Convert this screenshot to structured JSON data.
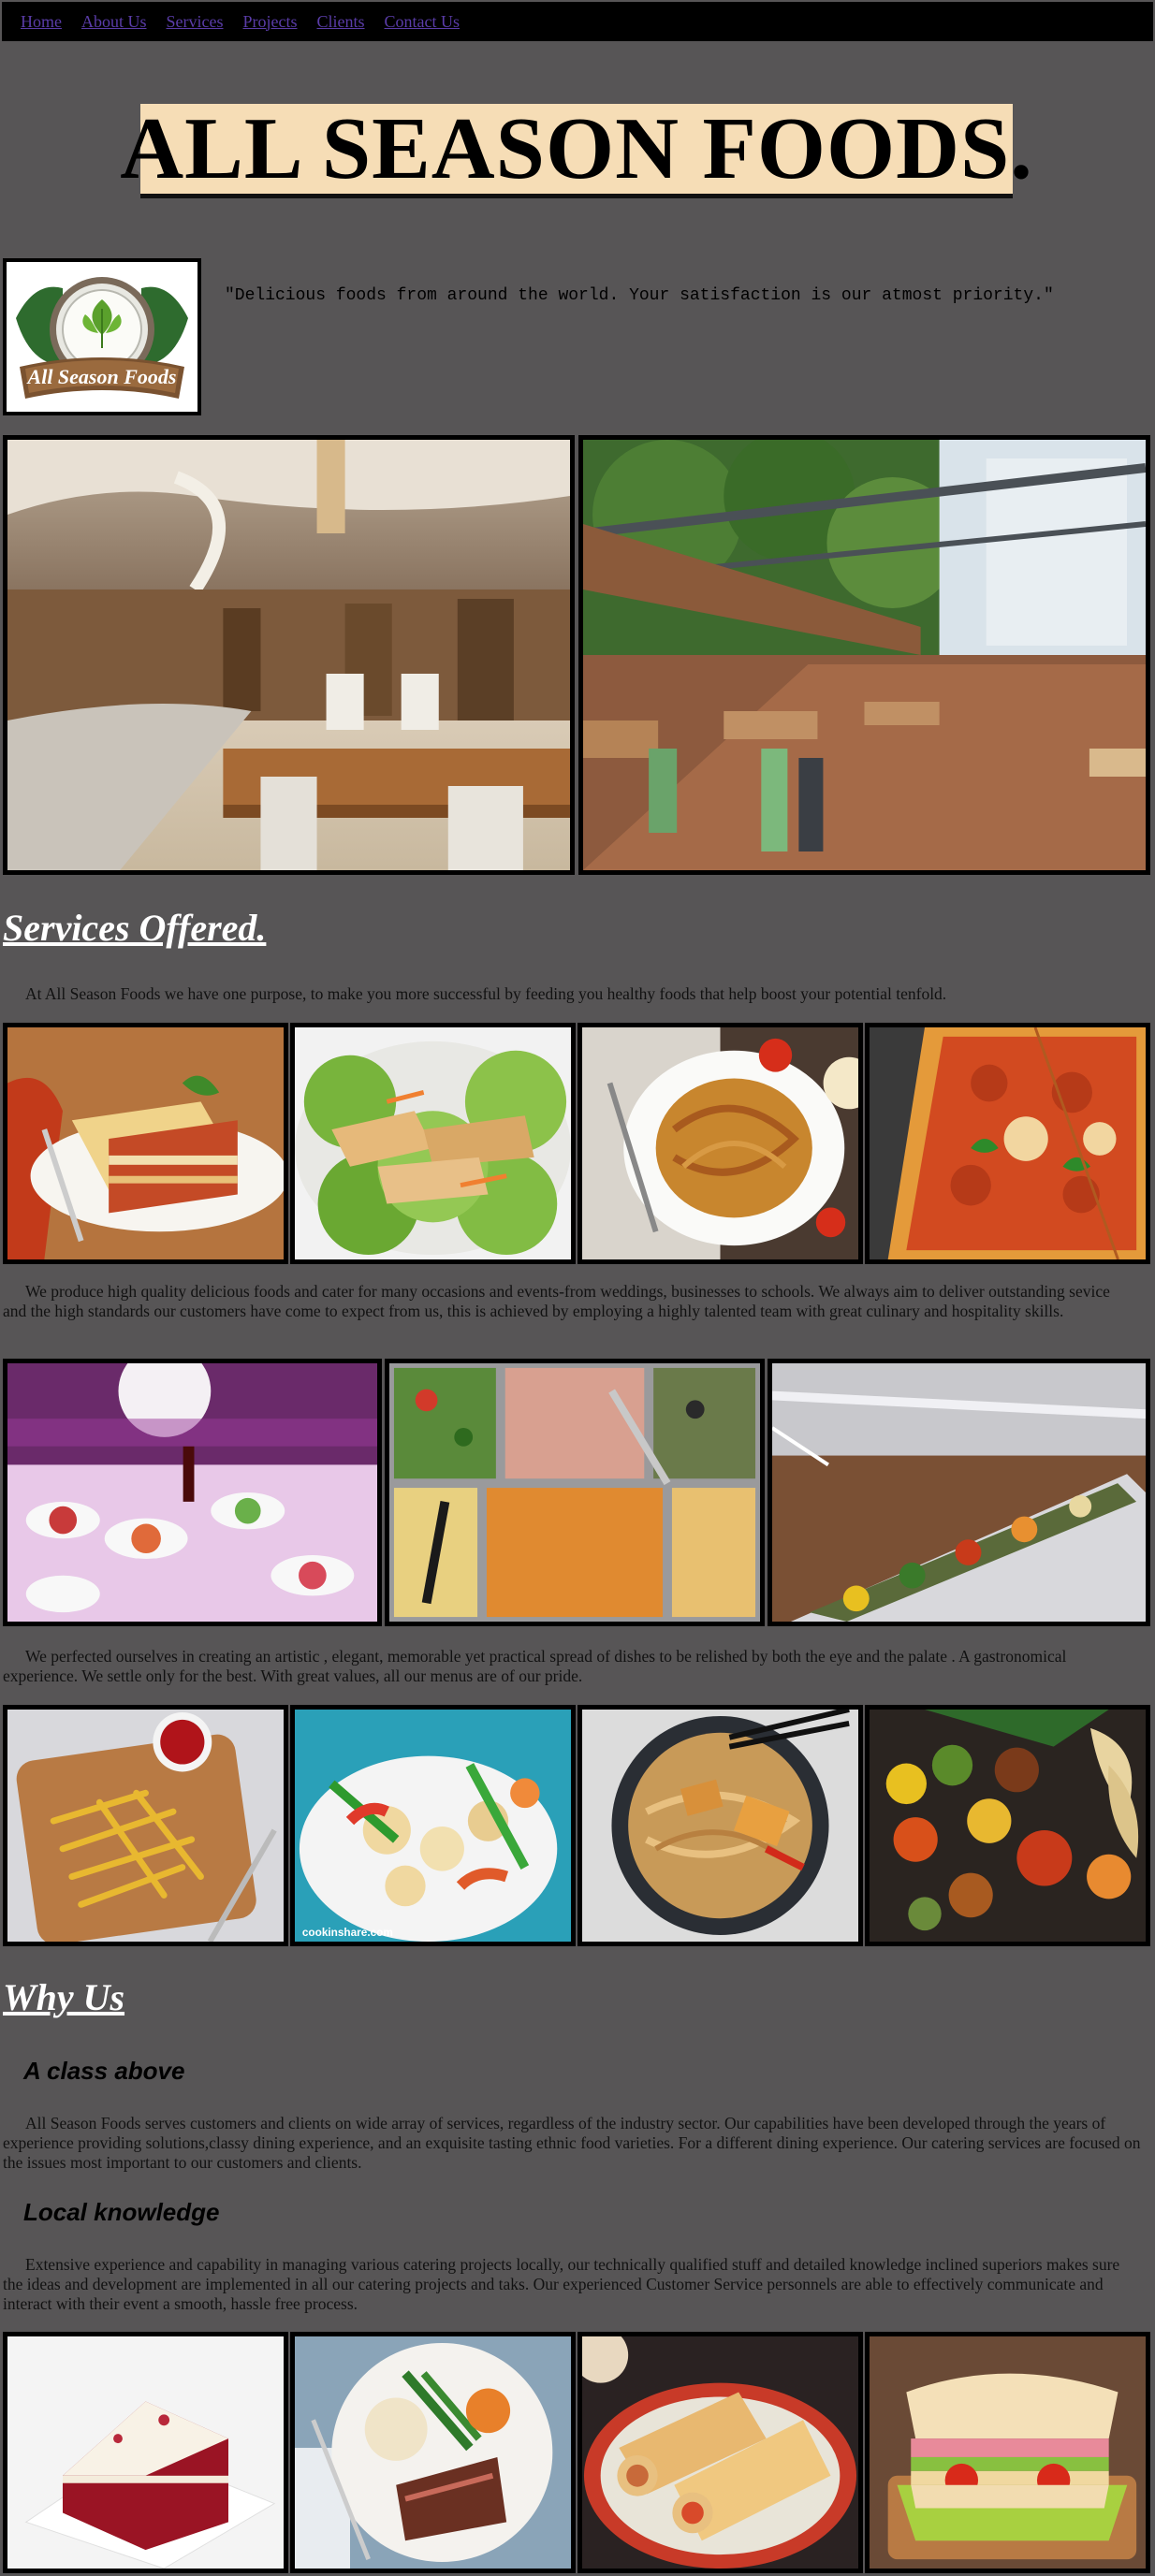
{
  "nav": {
    "items": [
      "Home",
      "About Us",
      "Services",
      "Projects",
      "Clients",
      "Contact Us"
    ]
  },
  "header": {
    "title": "ALL SEASON FOODS.",
    "tagline": "\"Delicious foods from around the world. Your satisfaction is our atmost priority.\"",
    "logo_text": "All Season Foods"
  },
  "services": {
    "heading": "Services Offered.",
    "intro": "At All Season Foods we have one purpose, to make you more successful by feeding you healthy foods that help boost your potential tenfold.",
    "para2": "We produce high quality delicious foods and cater for many occasions and events-from weddings, businesses to schools. We always aim to deliver outstanding sevice and the high standards our customers have come to expect from us, this is achieved by employing a highly talented team with great culinary and hospitality skills.",
    "para3": "We perfected ourselves in creating an artistic , elegant, memorable yet practical spread of dishes to be relished by both the eye and the palate . A gastronomical experience. We settle only for the best. With great values, all our menus are of our pride."
  },
  "why_us": {
    "heading": "Why Us",
    "sub1": "A class above",
    "para1": "All Season Foods serves customers and clients on wide array of services, regardless of the industry sector. Our capabilities have been developed through the years of experience providing solutions,classy dining experience, and an exquisite tasting ethnic food varieties. For a different dining experience. Our catering services are focused on the issues most important to our customers and clients.",
    "sub2": "Local knowledge",
    "para2": "Extensive experience and capability in managing various catering projects locally, our technically qualified stuff and detailed knowledge inclined superiors makes sure the ideas and development are implemented in all our catering projects and taks. Our experienced Customer Service personnels are able to effectively communicate and interact with their event a smooth, hassle free process."
  },
  "image_watermark": "cookinshare.com",
  "colors": {
    "page_bg": "#575556",
    "nav_bg": "#000000",
    "nav_link": "#5a3ca8",
    "title_bg": "#f6ddb6",
    "heading_text": "#ffffff"
  }
}
